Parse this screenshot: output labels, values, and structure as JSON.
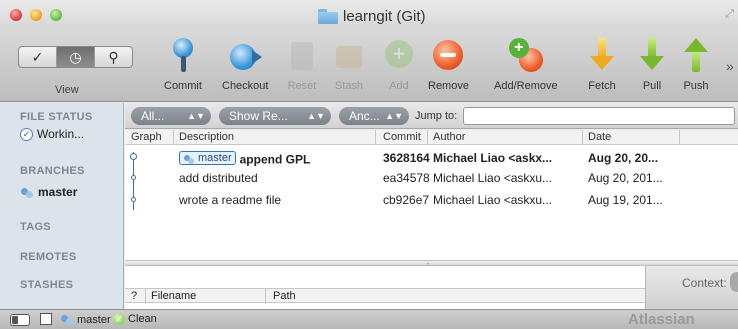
{
  "window": {
    "title": "learngit (Git)"
  },
  "toolbar": {
    "view_label": "View",
    "view_segments": [
      "✓",
      "◷",
      "⚲"
    ],
    "buttons": [
      {
        "label": "Commit",
        "icon": "commit-icon",
        "enabled": true
      },
      {
        "label": "Checkout",
        "icon": "checkout-icon",
        "enabled": true
      },
      {
        "label": "Reset",
        "icon": "reset-icon",
        "enabled": false
      },
      {
        "label": "Stash",
        "icon": "stash-icon",
        "enabled": false
      },
      {
        "label": "Add",
        "icon": "add-icon",
        "enabled": false
      },
      {
        "label": "Remove",
        "icon": "remove-icon",
        "enabled": true
      },
      {
        "label": "Add/Remove",
        "icon": "add-remove-icon",
        "enabled": true
      },
      {
        "label": "Fetch",
        "icon": "fetch-icon",
        "enabled": true
      },
      {
        "label": "Pull",
        "icon": "pull-icon",
        "enabled": true
      },
      {
        "label": "Push",
        "icon": "push-icon",
        "enabled": true
      }
    ],
    "overflow": "»"
  },
  "sidebar": {
    "file_status": {
      "heading": "FILE STATUS",
      "item": "Workin..."
    },
    "branches": {
      "heading": "BRANCHES",
      "item": "master"
    },
    "tags": {
      "heading": "TAGS"
    },
    "remotes": {
      "heading": "REMOTES"
    },
    "stashes": {
      "heading": "STASHES"
    }
  },
  "filter": {
    "branches": "All...",
    "show": "Show Re...",
    "order": "Anc...",
    "jump_label": "Jump to:",
    "jump_value": ""
  },
  "commits": {
    "headers": {
      "graph": "Graph",
      "description": "Description",
      "commit": "Commit",
      "author": "Author",
      "date": "Date"
    },
    "rows": [
      {
        "badge": "master",
        "description": "append GPL",
        "commit": "3628164",
        "author": "Michael Liao <askx...",
        "date": "Aug 20, 20...",
        "bold": true
      },
      {
        "badge": "",
        "description": "add distributed",
        "commit": "ea34578",
        "author": "Michael Liao <askxu...",
        "date": "Aug 20, 201...",
        "bold": false
      },
      {
        "badge": "",
        "description": "wrote a readme file",
        "commit": "cb926e7",
        "author": "Michael Liao <askxu...",
        "date": "Aug 19, 201...",
        "bold": false
      }
    ]
  },
  "files": {
    "headers": {
      "status": "?",
      "filename": "Filename",
      "path": "Path"
    },
    "context_label": "Context:"
  },
  "statusbar": {
    "branch": "master",
    "state": "Clean",
    "brand": "Atlassian"
  }
}
